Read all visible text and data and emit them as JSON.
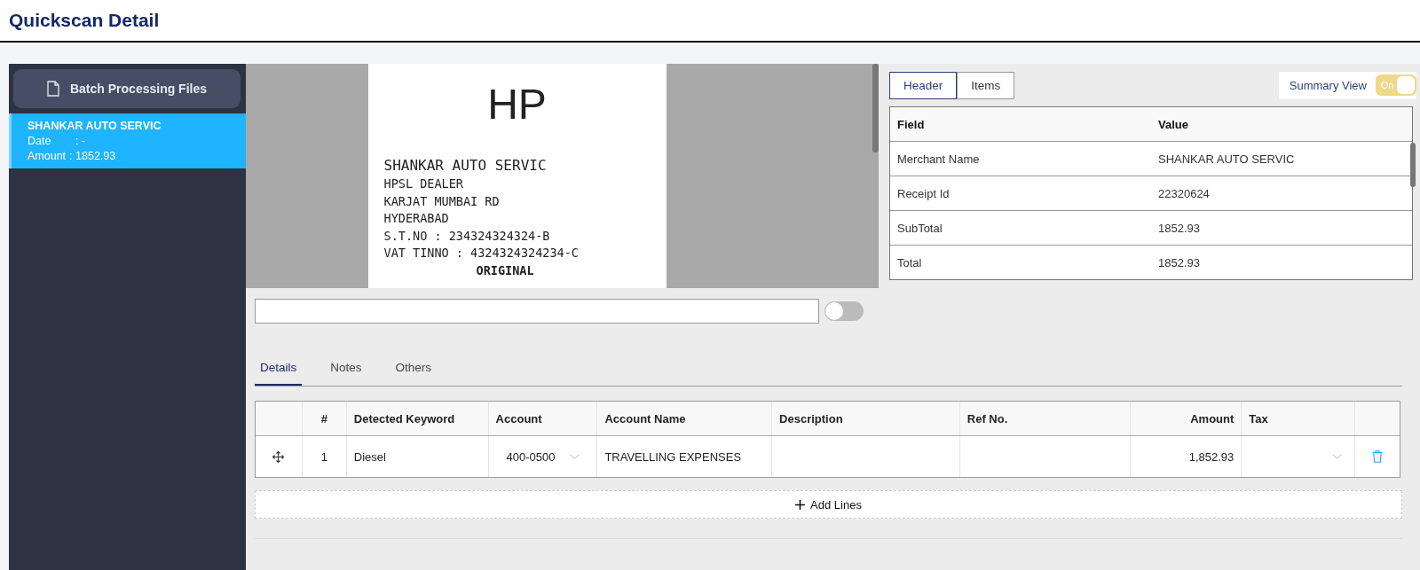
{
  "page": {
    "title": "Quickscan Detail"
  },
  "sidebar": {
    "button": "Batch Processing Files",
    "files": [
      {
        "merchant": "SHANKAR AUTO SERVIC",
        "date_label": "Date",
        "date": ": -",
        "amount_label": "Amount",
        "amount": ": 1852.93",
        "selected": true
      }
    ]
  },
  "receipt": {
    "logo": "HP",
    "lines": [
      {
        "text": "SHANKAR AUTO SERVIC",
        "kind": "large"
      },
      {
        "text": "HPSL DEALER",
        "kind": "normal"
      },
      {
        "text": "KARJAT MUMBAI RD",
        "kind": "normal"
      },
      {
        "text": "HYDERABAD",
        "kind": "normal"
      },
      {
        "text": "S.T.NO : 234324324324-B",
        "kind": "normal"
      },
      {
        "text": "VAT TINNO : 4324324324234-C",
        "kind": "normal"
      },
      {
        "text": "ORIGINAL",
        "kind": "bold"
      }
    ]
  },
  "summary": {
    "tabs": [
      {
        "label": "Header",
        "selected": true
      },
      {
        "label": "Items",
        "selected": false
      }
    ],
    "summary_view": {
      "label": "Summary View",
      "on": true,
      "state_text": "On"
    },
    "columns": [
      "Field",
      "Value"
    ],
    "rows": [
      {
        "field": "Merchant Name",
        "value": "SHANKAR AUTO SERVIC"
      },
      {
        "field": "Receipt Id",
        "value": "22320624"
      },
      {
        "field": "SubTotal",
        "value": "1852.93"
      },
      {
        "field": "Total",
        "value": "1852.93"
      }
    ]
  },
  "search": {
    "toggle_on": false
  },
  "detail_tabs": [
    {
      "label": "Details",
      "selected": true
    },
    {
      "label": "Notes",
      "selected": false
    },
    {
      "label": "Others",
      "selected": false
    }
  ],
  "lines_table": {
    "columns": [
      "#",
      "Detected Keyword",
      "Account",
      "Account Name",
      "Description",
      "Ref No.",
      "Amount",
      "Tax"
    ],
    "rows": [
      {
        "number": "1",
        "keyword": "Diesel",
        "account": "400-0500",
        "account_name": "TRAVELLING EXPENSES",
        "amount": "1,852.93"
      }
    ],
    "add_button": "Add Lines"
  }
}
